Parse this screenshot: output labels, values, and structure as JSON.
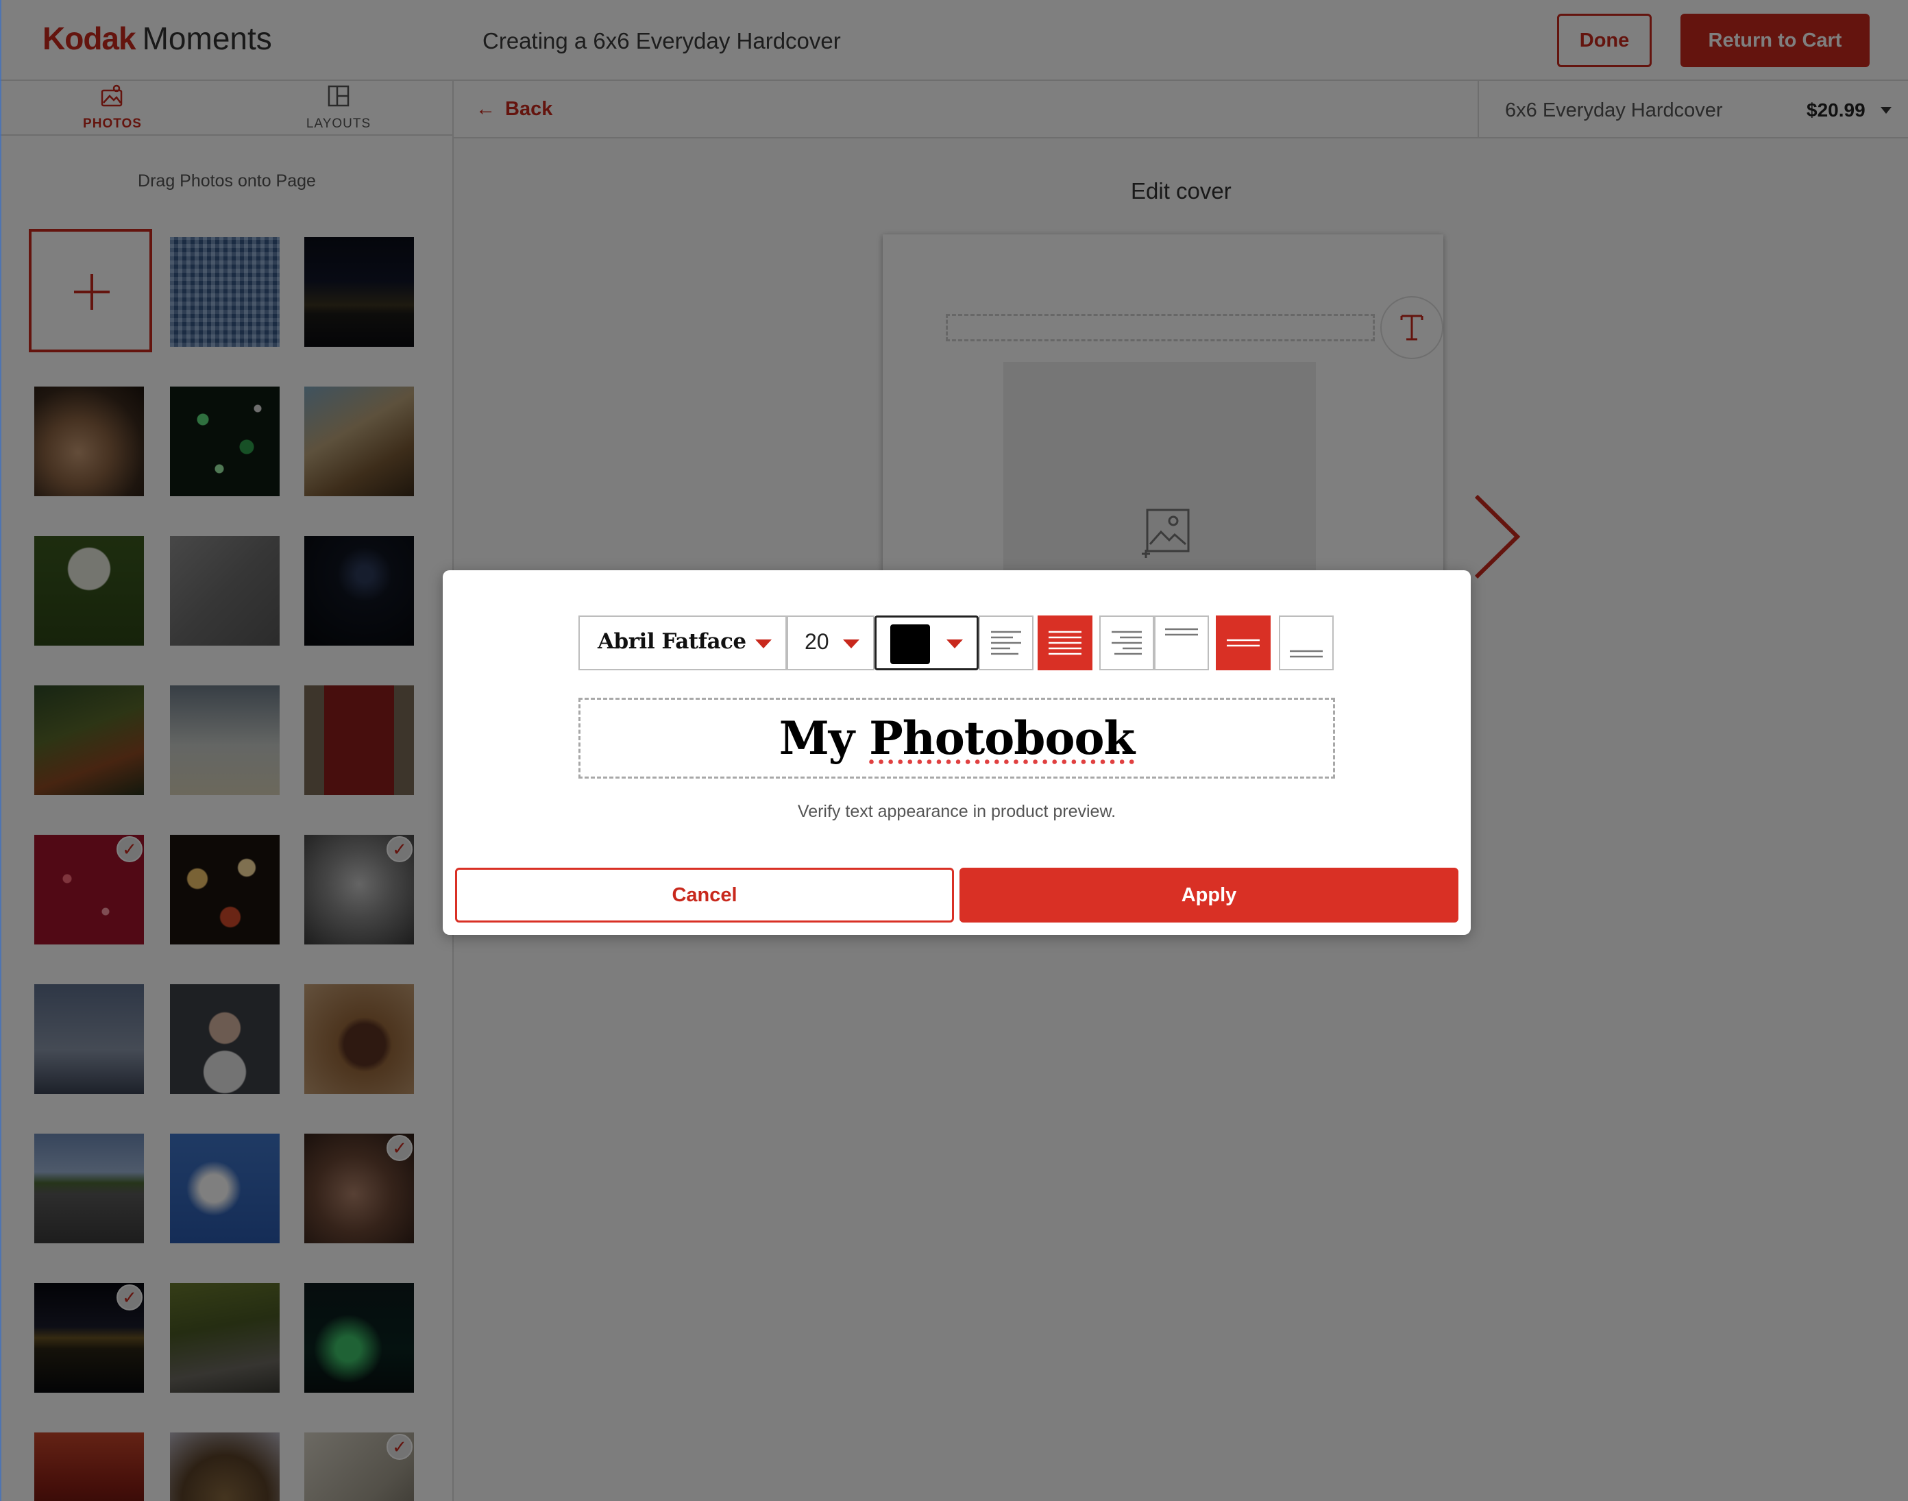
{
  "header": {
    "logo_brand": "Kodak",
    "logo_product": "Moments",
    "title": "Creating a 6x6 Everyday Hardcover",
    "done_label": "Done",
    "return_label": "Return to Cart"
  },
  "sidebar": {
    "tabs": [
      {
        "label": "PHOTOS",
        "icon": "photos-icon",
        "active": true
      },
      {
        "label": "LAYOUTS",
        "icon": "layouts-icon",
        "active": false
      }
    ],
    "hint": "Drag Photos onto Page",
    "add_photo_icon": "plus-icon",
    "photos": [
      {
        "name": "blue-mosaic",
        "checked": false
      },
      {
        "name": "city-night-skyline",
        "checked": false
      },
      {
        "name": "guitar-hands",
        "checked": false
      },
      {
        "name": "green-bokeh",
        "checked": false
      },
      {
        "name": "horse-mane",
        "checked": false
      },
      {
        "name": "dandelion",
        "checked": false
      },
      {
        "name": "sand-hearts",
        "checked": false
      },
      {
        "name": "night-moon",
        "checked": false
      },
      {
        "name": "autumn-forest",
        "checked": false
      },
      {
        "name": "wind-turbines",
        "checked": false
      },
      {
        "name": "red-door",
        "checked": false
      },
      {
        "name": "red-glitter",
        "checked": true
      },
      {
        "name": "warm-bokeh",
        "checked": false
      },
      {
        "name": "old-man-portrait",
        "checked": true
      },
      {
        "name": "space-needle",
        "checked": false
      },
      {
        "name": "woman-on-stones",
        "checked": false
      },
      {
        "name": "steak-plate",
        "checked": false
      },
      {
        "name": "open-road",
        "checked": false
      },
      {
        "name": "blue-sky-clouds",
        "checked": false
      },
      {
        "name": "face-rings",
        "checked": true
      },
      {
        "name": "night-city-reflection",
        "checked": true
      },
      {
        "name": "forest-creek",
        "checked": false
      },
      {
        "name": "aurora",
        "checked": false
      },
      {
        "name": "red-sunset",
        "checked": false
      },
      {
        "name": "puppy",
        "checked": false
      },
      {
        "name": "book-pencil",
        "checked": true
      }
    ]
  },
  "main": {
    "back_label": "Back",
    "product_name": "6x6 Everyday Hardcover",
    "product_price": "$20.99",
    "edit_title": "Edit cover"
  },
  "modal": {
    "font": "Abril Fatface",
    "size": "20",
    "color": "#000000",
    "align_buttons": [
      {
        "name": "align-left",
        "active": false
      },
      {
        "name": "align-center",
        "active": true
      },
      {
        "name": "align-right",
        "active": false
      },
      {
        "name": "valign-top",
        "active": false
      },
      {
        "name": "valign-middle",
        "active": true
      },
      {
        "name": "valign-bottom",
        "active": false
      }
    ],
    "text_value_word1": "My",
    "text_value_word2": "Photobook",
    "verify_text": "Verify text appearance in product preview.",
    "cancel_label": "Cancel",
    "apply_label": "Apply"
  },
  "colors": {
    "brand_red": "#c8281c",
    "active_red": "#d93025"
  }
}
